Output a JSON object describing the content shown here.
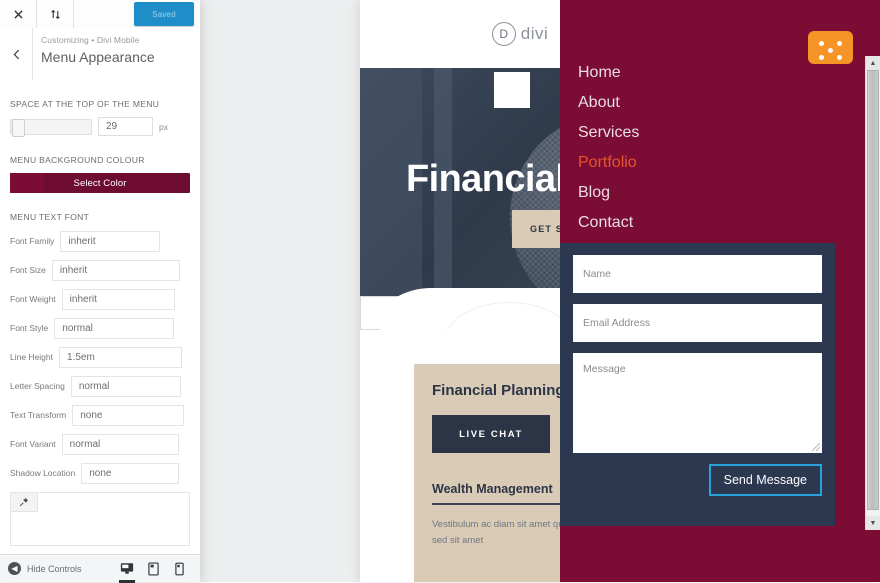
{
  "customizer": {
    "toolbar": {
      "close_icon": "close-icon",
      "reorder_icon": "sort-arrows-icon",
      "publish_label": "Saved"
    },
    "header": {
      "back_icon": "chevron-left-icon",
      "breadcrumb": "Customizing • Divi Mobile",
      "title": "Menu Appearance"
    },
    "sections": [
      {
        "label": "SPACE AT THE TOP OF THE MENU",
        "slider_value": "29",
        "unit": "px"
      },
      {
        "label": "MENU BACKGROUND COLOUR",
        "button_label": "Select Color",
        "swatch_color": "#7b0d35"
      },
      {
        "label": "MENU TEXT FONT"
      }
    ],
    "font_fields": [
      {
        "label": "Font Family",
        "value": "inherit"
      },
      {
        "label": "Font Size",
        "value": "inherit"
      },
      {
        "label": "Font Weight",
        "value": "inherit"
      },
      {
        "label": "Font Style",
        "value": "normal"
      },
      {
        "label": "Line Height",
        "value": "1.5em"
      },
      {
        "label": "Letter Spacing",
        "value": "normal"
      },
      {
        "label": "Text Transform",
        "value": "none"
      },
      {
        "label": "Font Variant",
        "value": "normal"
      },
      {
        "label": "Shadow Location",
        "value": "none"
      }
    ],
    "pin_card": {
      "pin_icon": "pin-icon"
    },
    "footer": {
      "hide_icon": "collapse-left-icon",
      "hide_label": "Hide Controls",
      "devices": [
        {
          "name": "desktop",
          "icon": "desktop-icon",
          "active": true
        },
        {
          "name": "tablet",
          "icon": "tablet-icon",
          "active": false
        },
        {
          "name": "mobile",
          "icon": "mobile-icon",
          "active": false
        }
      ]
    }
  },
  "preview": {
    "site": {
      "logo_mark": "D",
      "logo_text": "divi",
      "hero_title": "Financial",
      "hero_cta": "GET STARTED",
      "card_title": "Financial Planning",
      "live_chat": "LIVE CHAT",
      "wealth_title": "Wealth Management",
      "wealth_body": "Vestibulum ac diam sit amet quam vehicula elementum sed sit amet"
    },
    "menu": {
      "toggle_icon": "menu-dots-icon",
      "toggle_color": "#f79428",
      "background_color": "#7b0d35",
      "items": [
        {
          "label": "Home",
          "current": false
        },
        {
          "label": "About",
          "current": false
        },
        {
          "label": "Services",
          "current": false
        },
        {
          "label": "Portfolio",
          "current": true
        },
        {
          "label": "Blog",
          "current": false
        },
        {
          "label": "Contact",
          "current": false
        }
      ],
      "current_color": "#e8522c"
    },
    "contact_form": {
      "name_placeholder": "Name",
      "email_placeholder": "Email Address",
      "message_placeholder": "Message",
      "submit_label": "Send Message",
      "accent_color": "#29a3dc",
      "background_color": "#2b3850"
    },
    "scrollbar": {
      "up_arrow": "▲",
      "down_arrow": "▼"
    }
  }
}
